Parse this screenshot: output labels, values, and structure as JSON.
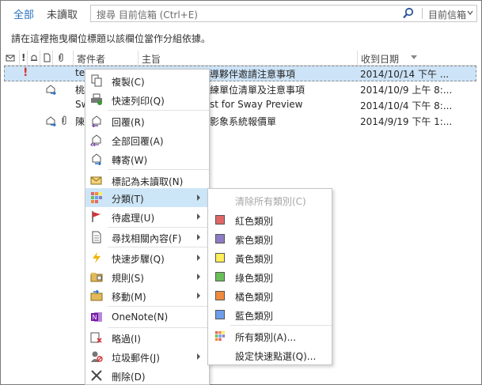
{
  "tabs": {
    "all": "全部",
    "unread": "未讀取"
  },
  "search": {
    "placeholder": "搜尋 目前信箱 (Ctrl+E)",
    "scope": "目前信箱",
    "icon": "search-icon"
  },
  "group_hint": "請在這裡拖曳欄位標題以該欄位當作分組依據。",
  "columns": {
    "sender": "寄件者",
    "subject": "主旨",
    "received": "收到日期"
  },
  "messages": [
    {
      "sender": "te",
      "subject": "導夥伴邀請注意事項",
      "date": "2014/10/14 下午 ...",
      "important": true,
      "selected": true
    },
    {
      "sender": "桃",
      "subject": "練單位清單及注意事項",
      "date": "2014/10/9 上午 8:...",
      "forwarded": true
    },
    {
      "sender": "Sw",
      "subject": "st for Sway Preview",
      "date": "2014/10/4 下午 8:..."
    },
    {
      "sender": "陳",
      "subject": "影象系統報價單",
      "date": "2014/9/19 下午 1:...",
      "forwarded": true,
      "attachment": true
    }
  ],
  "context_menu": [
    {
      "label": "複製(C)",
      "icon": "copy-icon"
    },
    {
      "label": "快速列印(Q)",
      "icon": "print-icon"
    },
    {
      "label": "回覆(R)",
      "icon": "reply-icon"
    },
    {
      "label": "全部回覆(A)",
      "icon": "reply-all-icon"
    },
    {
      "label": "轉寄(W)",
      "icon": "forward-icon"
    },
    {
      "label": "標記為未讀取(N)",
      "icon": "mark-unread-icon"
    },
    {
      "label": "分類(T)",
      "icon": "categorize-icon",
      "submenu": true
    },
    {
      "label": "待處理(U)",
      "icon": "flag-icon",
      "submenu": true
    },
    {
      "label": "尋找相關內容(F)",
      "icon": "find-related-icon",
      "submenu": true
    },
    {
      "label": "快速步驟(Q)",
      "icon": "quick-steps-icon",
      "submenu": true
    },
    {
      "label": "規則(S)",
      "icon": "rules-icon",
      "submenu": true
    },
    {
      "label": "移動(M)",
      "icon": "move-icon",
      "submenu": true
    },
    {
      "label": "OneNote(N)",
      "icon": "onenote-icon"
    },
    {
      "label": "略過(I)",
      "icon": "ignore-icon"
    },
    {
      "label": "垃圾郵件(J)",
      "icon": "junk-icon",
      "submenu": true
    },
    {
      "label": "刪除(D)",
      "icon": "delete-icon"
    }
  ],
  "category_submenu": {
    "clear": "清除所有類別(C)",
    "categories": [
      {
        "label": "紅色類別",
        "color": "#e06666"
      },
      {
        "label": "紫色類別",
        "color": "#8e7cc3"
      },
      {
        "label": "黃色類別",
        "color": "#ffee58"
      },
      {
        "label": "綠色類別",
        "color": "#6abf59"
      },
      {
        "label": "橘色類別",
        "color": "#f08a3c"
      },
      {
        "label": "藍色類別",
        "color": "#6d9eeb"
      }
    ],
    "all": "所有類別(A)...",
    "quick_click": "設定快速點選(Q)..."
  }
}
